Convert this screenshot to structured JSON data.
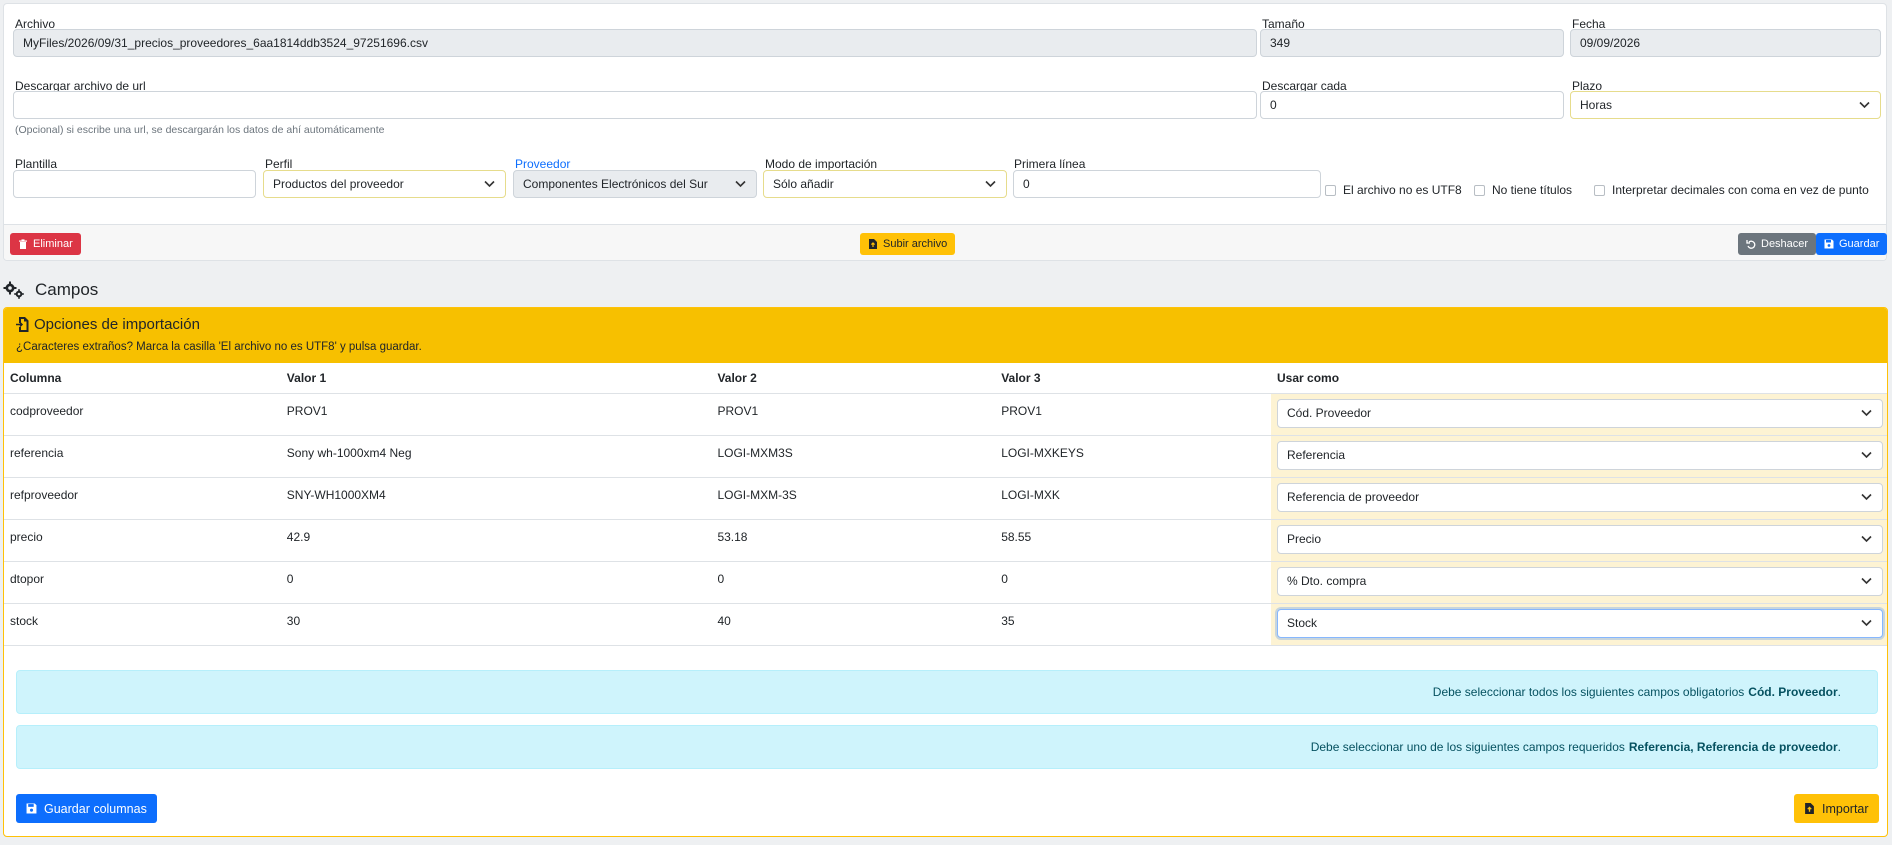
{
  "file": {
    "archivo_label": "Archivo",
    "archivo_value": "MyFiles/2026/09/31_precios_proveedores_6aa1814ddb3524_97251696.csv",
    "tamano_label": "Tamaño",
    "tamano_value": "349",
    "fecha_label": "Fecha",
    "fecha_value": "09/09/2026",
    "url_label": "Descargar archivo de url",
    "url_value": "",
    "url_help": "(Opcional) si escribe una url, se descargarán los datos de ahí automáticamente",
    "cada_label": "Descargar cada",
    "cada_value": "0",
    "plazo_label": "Plazo",
    "plazo_value": "Horas",
    "plantilla_label": "Plantilla",
    "plantilla_value": "",
    "perfil_label": "Perfil",
    "perfil_value": "Productos del proveedor",
    "proveedor_label": "Proveedor",
    "proveedor_value": "Componentes Electrónicos del Sur",
    "modo_label": "Modo de importación",
    "modo_value": "Sólo añadir",
    "primera_label": "Primera línea",
    "primera_value": "0",
    "chk_utf8": "El archivo no es UTF8",
    "chk_titulos": "No tiene títulos",
    "chk_decimales": "Interpretar decimales con coma en vez de punto"
  },
  "toolbar": {
    "eliminar": "Eliminar",
    "subir": "Subir archivo",
    "deshacer": "Deshacer",
    "guardar": "Guardar"
  },
  "section": {
    "title": "Campos"
  },
  "options": {
    "title": "Opciones de importación",
    "subtitle": "¿Caracteres extraños? Marca la casilla 'El archivo no es UTF8' y pulsa guardar."
  },
  "table": {
    "headers": [
      "Columna",
      "Valor 1",
      "Valor 2",
      "Valor 3",
      "Usar como"
    ],
    "rows": [
      {
        "col": "codproveedor",
        "v1": "PROV1",
        "v2": "PROV1",
        "v3": "PROV1",
        "usar": "Cód. Proveedor"
      },
      {
        "col": "referencia",
        "v1": "Sony wh-1000xm4 Neg",
        "v2": "LOGI-MXM3S",
        "v3": "LOGI-MXKEYS",
        "usar": "Referencia"
      },
      {
        "col": "refproveedor",
        "v1": "SNY-WH1000XM4",
        "v2": "LOGI-MXM-3S",
        "v3": "LOGI-MXK",
        "usar": "Referencia de proveedor"
      },
      {
        "col": "precio",
        "v1": "42.9",
        "v2": "53.18",
        "v3": "58.55",
        "usar": "Precio"
      },
      {
        "col": "dtopor",
        "v1": "0",
        "v2": "0",
        "v3": "0",
        "usar": "% Dto. compra"
      },
      {
        "col": "stock",
        "v1": "30",
        "v2": "40",
        "v3": "35",
        "usar": "Stock"
      }
    ]
  },
  "alerts": {
    "a1_text": "Debe seleccionar todos los siguientes campos obligatorios",
    "a1_bold": "Cód. Proveedor",
    "a2_text": "Debe seleccionar uno de los siguientes campos requeridos",
    "a2_bold": "Referencia, Referencia de proveedor"
  },
  "actions": {
    "guardar_columnas": "Guardar columnas",
    "importar": "Importar"
  }
}
